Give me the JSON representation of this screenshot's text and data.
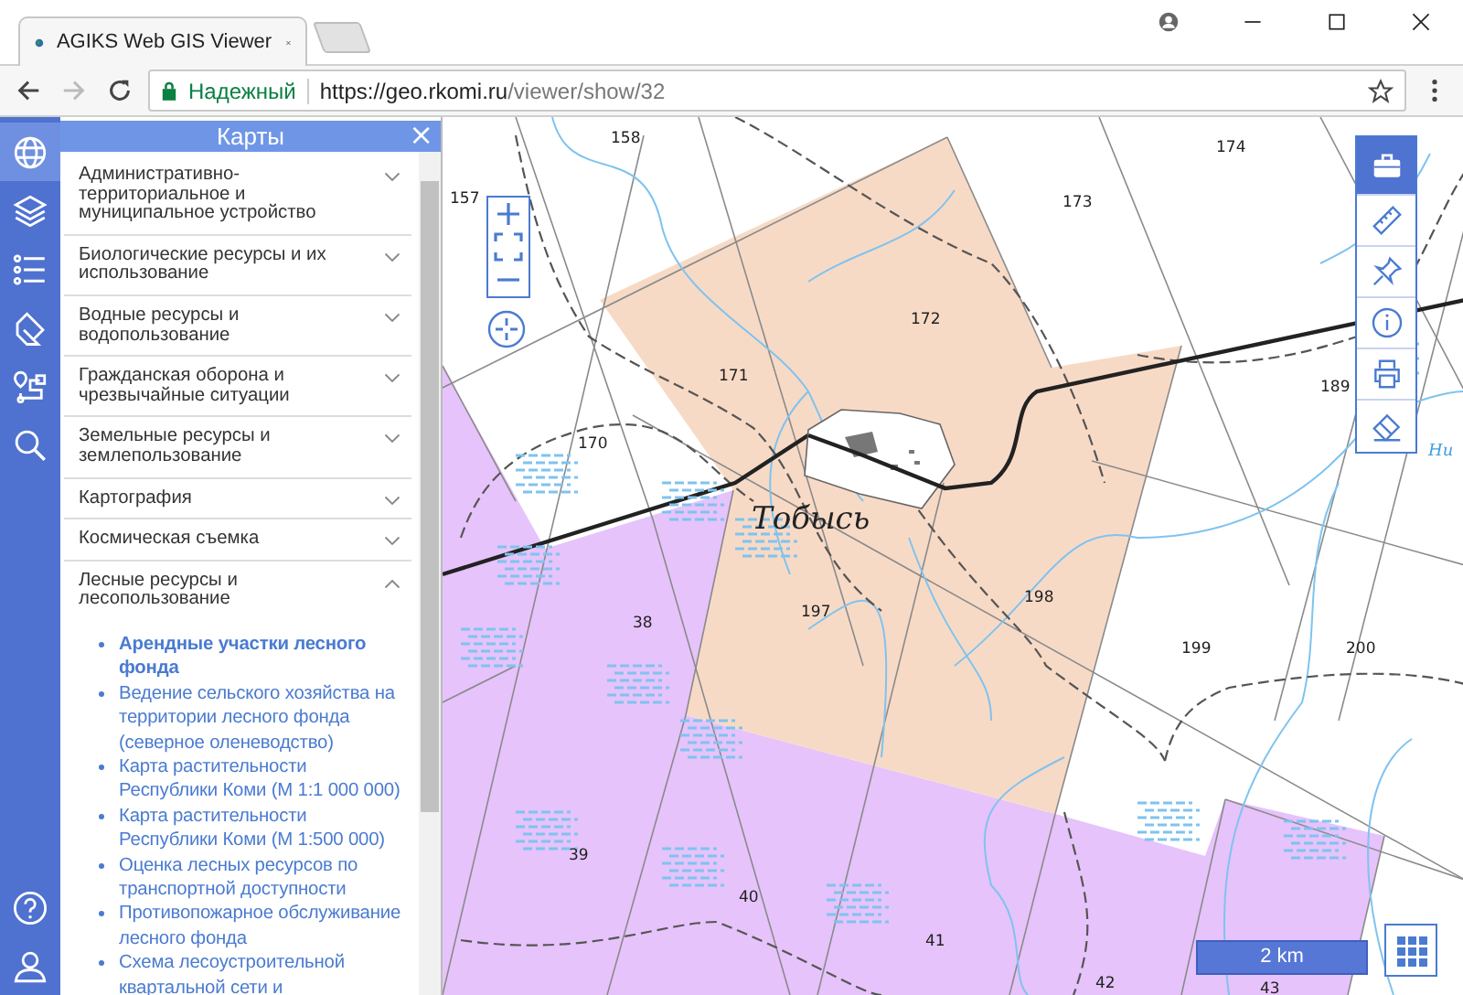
{
  "browser": {
    "tab_title": "AGIKS Web GIS Viewer",
    "secure_label": "Надежный",
    "url_host": "https://geo.rkomi.ru",
    "url_path": "/viewer/show/32"
  },
  "sidebar": {
    "items": [
      {
        "kind": "globe",
        "selected": true
      },
      {
        "kind": "layers",
        "selected": false
      },
      {
        "kind": "list",
        "selected": false
      },
      {
        "kind": "tag",
        "selected": false
      },
      {
        "kind": "route",
        "selected": false
      },
      {
        "kind": "search",
        "selected": false
      }
    ],
    "bottom_items": [
      {
        "kind": "help"
      },
      {
        "kind": "user"
      }
    ]
  },
  "panel": {
    "title": "Карты",
    "close": "×",
    "items": [
      {
        "label": "Административно-территориальное и муниципальное устройство",
        "expanded": false
      },
      {
        "label": "Биологические ресурсы и их использование",
        "expanded": false
      },
      {
        "label": "Водные ресурсы и водопользование",
        "expanded": false
      },
      {
        "label": "Гражданская оборона и чрезвычайные ситуации",
        "expanded": false
      },
      {
        "label": "Земельные ресурсы и землепользование",
        "expanded": false
      },
      {
        "label": "Картография",
        "expanded": false
      },
      {
        "label": "Космическая съемка",
        "expanded": false
      },
      {
        "label": "Лесные ресурсы и лесопользование",
        "expanded": true,
        "children": [
          {
            "label": "Арендные участки лесного фонда",
            "selected": true
          },
          {
            "label": "Ведение сельского хозяйства на территории лесного фонда (северное оленеводство)",
            "selected": false
          },
          {
            "label": "Карта растительности Республики Коми (М 1:1 000 000)",
            "selected": false
          },
          {
            "label": "Карта растительности Республики Коми (М 1:500 000)",
            "selected": false
          },
          {
            "label": "Оценка лесных ресурсов по транспортной доступности",
            "selected": false
          },
          {
            "label": "Противопожарное обслуживание лесного фонда",
            "selected": false
          },
          {
            "label": "Схема лесоустроительной квартальной сети и",
            "selected": false
          }
        ]
      }
    ]
  },
  "map": {
    "labels": [
      {
        "text": "158",
        "kind": "parcel"
      },
      {
        "text": "157",
        "kind": "parcel"
      },
      {
        "text": "174",
        "kind": "parcel"
      },
      {
        "text": "173",
        "kind": "parcel"
      },
      {
        "text": "172",
        "kind": "parcel"
      },
      {
        "text": "171",
        "kind": "parcel"
      },
      {
        "text": "170",
        "kind": "parcel"
      },
      {
        "text": "189",
        "kind": "parcel"
      },
      {
        "text": "Ни",
        "kind": "river"
      },
      {
        "text": "Тобысь",
        "kind": "settlement"
      },
      {
        "text": "198",
        "kind": "parcel"
      },
      {
        "text": "38",
        "kind": "parcel"
      },
      {
        "text": "197",
        "kind": "parcel"
      },
      {
        "text": "199",
        "kind": "parcel"
      },
      {
        "text": "200",
        "kind": "parcel"
      },
      {
        "text": "39",
        "kind": "parcel"
      },
      {
        "text": "40",
        "kind": "parcel"
      },
      {
        "text": "41",
        "kind": "parcel"
      },
      {
        "text": "42",
        "kind": "parcel"
      },
      {
        "text": "43",
        "kind": "parcel"
      }
    ],
    "tools": [
      {
        "kind": "toolbox",
        "selected": true
      },
      {
        "kind": "ruler",
        "selected": false
      },
      {
        "kind": "pin",
        "selected": false
      },
      {
        "kind": "info",
        "selected": false
      },
      {
        "kind": "print",
        "selected": false
      },
      {
        "kind": "eraser",
        "selected": false
      }
    ],
    "scale": "2 km"
  }
}
